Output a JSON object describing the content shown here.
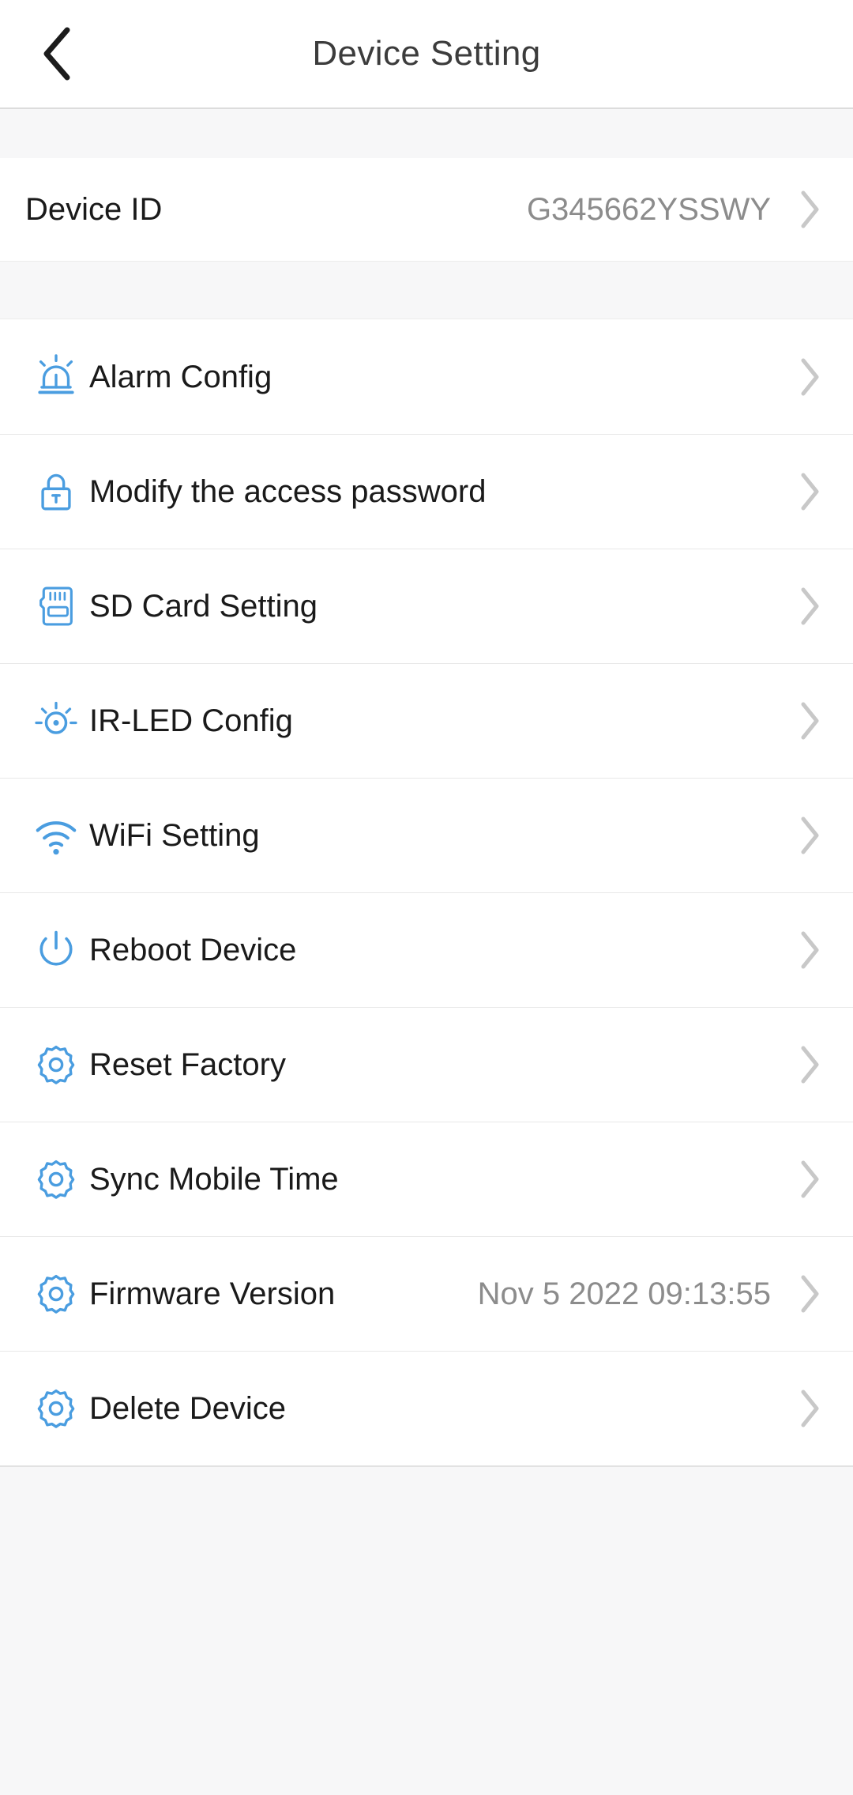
{
  "header": {
    "title": "Device Setting",
    "back_icon": "chevron-left-icon"
  },
  "colors": {
    "icon_blue": "#4a9de0",
    "chevron_gray": "#c8c8c8",
    "value_gray": "#8c8c8c",
    "label_black": "#1a1a1a",
    "page_bg": "#f7f7f8",
    "card_bg": "#ffffff",
    "divider": "#e8e8e8"
  },
  "device_id_row": {
    "label": "Device ID",
    "value": "G345662YSSWY",
    "chevron_icon": "chevron-right-icon"
  },
  "menu": {
    "items": [
      {
        "label": "Alarm Config",
        "icon": "alarm-siren-icon",
        "value": "",
        "chevron_icon": "chevron-right-icon"
      },
      {
        "label": "Modify the access password",
        "icon": "lock-icon",
        "value": "",
        "chevron_icon": "chevron-right-icon"
      },
      {
        "label": "SD Card Setting",
        "icon": "sd-card-icon",
        "value": "",
        "chevron_icon": "chevron-right-icon"
      },
      {
        "label": "IR-LED Config",
        "icon": "brightness-sun-icon",
        "value": "",
        "chevron_icon": "chevron-right-icon"
      },
      {
        "label": "WiFi Setting",
        "icon": "wifi-icon",
        "value": "",
        "chevron_icon": "chevron-right-icon"
      },
      {
        "label": "Reboot Device",
        "icon": "power-icon",
        "value": "",
        "chevron_icon": "chevron-right-icon"
      },
      {
        "label": "Reset Factory",
        "icon": "gear-icon",
        "value": "",
        "chevron_icon": "chevron-right-icon"
      },
      {
        "label": "Sync Mobile Time",
        "icon": "gear-icon",
        "value": "",
        "chevron_icon": "chevron-right-icon"
      },
      {
        "label": "Firmware Version",
        "icon": "gear-icon",
        "value": "Nov  5 2022 09:13:55",
        "chevron_icon": "chevron-right-icon"
      },
      {
        "label": "Delete Device",
        "icon": "gear-icon",
        "value": "",
        "chevron_icon": "chevron-right-icon"
      }
    ]
  }
}
